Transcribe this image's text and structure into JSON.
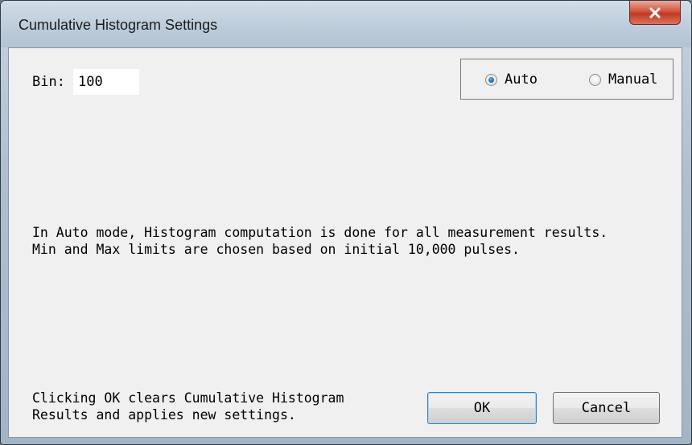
{
  "window": {
    "title": "Cumulative Histogram Settings"
  },
  "bin": {
    "label": "Bin:",
    "value": "100"
  },
  "mode": {
    "options": [
      {
        "label": "Auto",
        "selected": true
      },
      {
        "label": "Manual",
        "selected": false
      }
    ]
  },
  "info": {
    "line1": "In Auto mode, Histogram computation is done for all measurement results.",
    "line2": "Min and Max limits are chosen based on initial 10,000 pulses."
  },
  "footer": {
    "line1": "Clicking OK clears Cumulative Histogram",
    "line2": "Results and applies new settings."
  },
  "buttons": {
    "ok": "OK",
    "cancel": "Cancel"
  },
  "icons": {
    "close": "close-icon"
  },
  "colors": {
    "close_button": "#c23a22",
    "radio_selected": "#1c6aa8",
    "client_background": "#f0f0f0"
  }
}
